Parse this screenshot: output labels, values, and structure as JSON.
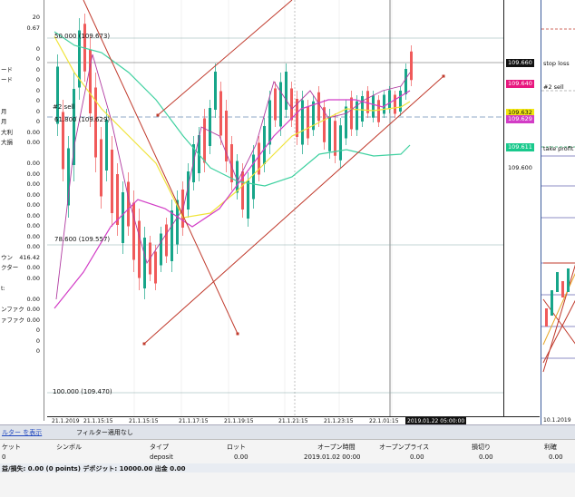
{
  "left_panel": {
    "rows": [
      {
        "label": "",
        "value": "20"
      },
      {
        "label": "",
        "value": "0.67"
      },
      {
        "label": "",
        "value": ""
      },
      {
        "label": "",
        "value": "0"
      },
      {
        "label": "",
        "value": "0"
      },
      {
        "label": "ード",
        "value": "0"
      },
      {
        "label": "ード",
        "value": "0"
      },
      {
        "label": "",
        "value": "0"
      },
      {
        "label": "",
        "value": "0"
      },
      {
        "label": "月",
        "value": "0"
      },
      {
        "label": "月",
        "value": "0"
      },
      {
        "label": "大利",
        "value": "0.00"
      },
      {
        "label": "大損",
        "value": "0.00"
      },
      {
        "label": "",
        "value": ""
      },
      {
        "label": "",
        "value": "0.00"
      },
      {
        "label": "",
        "value": "0.00"
      },
      {
        "label": "",
        "value": "0.00"
      },
      {
        "label": "",
        "value": "0.00"
      },
      {
        "label": "",
        "value": "0.00"
      },
      {
        "label": "",
        "value": "0.00"
      },
      {
        "label": "",
        "value": "0.00"
      },
      {
        "label": "",
        "value": "0.00"
      },
      {
        "label": "",
        "value": "0.00"
      },
      {
        "label": "ウン",
        "value": "416.42"
      },
      {
        "label": "クター",
        "value": "0.00"
      },
      {
        "label": "",
        "value": "0.00"
      },
      {
        "label": "t:",
        "value": ""
      },
      {
        "label": "",
        "value": "0.00"
      },
      {
        "label": "ンファク",
        "value": "0.00"
      },
      {
        "label": "ァファク",
        "value": "0.00"
      },
      {
        "label": "",
        "value": "0"
      },
      {
        "label": "",
        "value": "0"
      },
      {
        "label": "",
        "value": "0"
      }
    ]
  },
  "chart": {
    "fib_labels": {
      "f50": "50.000 (109.673)",
      "f618": "61.800 (109.629)",
      "f786": "78.600 (109.557)",
      "f100": "100.000 (109.470)",
      "sell": "#2 sell"
    },
    "time_labels": [
      "21.1.2019",
      "21.1.15:15",
      "21.1.15:15",
      "21.1.17:15",
      "21.1.19:15",
      "21.1.21:15",
      "21.1.23:15",
      "22.1.01:15",
      "2019.01.22 05:00:00"
    ],
    "colors": {
      "up": "#17a589",
      "down": "#f05a5a",
      "trend": "#c0392b",
      "ma_green": "#3fd1a0",
      "ma_yellow": "#f0e43a",
      "ma_magenta": "#d23cc6"
    }
  },
  "price_axis": {
    "labels": [
      {
        "text": "109.660",
        "bg": "#111111",
        "fg": "#ffffff"
      },
      {
        "text": "109.640",
        "bg": "#e8177f",
        "fg": "#ffffff"
      },
      {
        "text": "109.632",
        "bg": "#f2e611",
        "fg": "#111111"
      },
      {
        "text": "109.629",
        "bg": "#d23cc6",
        "fg": "#ffffff"
      },
      {
        "text": "109.611",
        "bg": "#19c98c",
        "fg": "#ffffff"
      },
      {
        "text": "109.600",
        "bg": "",
        "fg": "#111111"
      }
    ]
  },
  "mini_chart": {
    "stop_loss": "stop loss",
    "sell": "#2 sell",
    "take_profit": "take profit",
    "time": "10.1.2019"
  },
  "filter_bar": {
    "show_filter": "ルター を表示",
    "filter_off": "フィルター適用なし"
  },
  "table": {
    "headers": [
      "ケット",
      "シンボル",
      "タイプ",
      "ロット",
      "オープン時間",
      "オープンプライス",
      "損切り",
      "利確"
    ],
    "row": [
      "0",
      "",
      "deposit",
      "0.00",
      "2019.01.02 00:00",
      "0.00",
      "0.00",
      "0.00"
    ]
  },
  "footer": {
    "summary": "益/損失: 0.00 (0 points) デポジット: 10000.00 出金 0.00"
  }
}
